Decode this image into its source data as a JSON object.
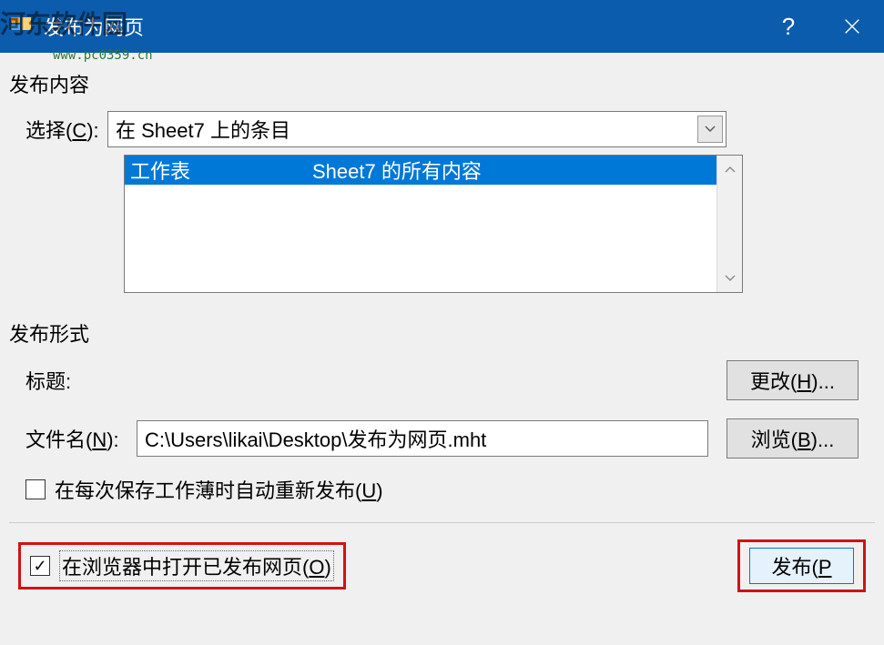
{
  "titlebar": {
    "title": "发布为网页",
    "help_symbol": "?",
    "watermark_text": "河东软件园",
    "watermark_url": "www.pc0359.cn"
  },
  "section_publish_content": {
    "title": "发布内容",
    "choose_label_prefix": "选择(",
    "choose_label_key": "C",
    "choose_label_suffix": "):",
    "choose_value": "在 Sheet7 上的条目",
    "list_item_col1": "工作表",
    "list_item_col2": "Sheet7 的所有内容"
  },
  "section_publish_form": {
    "title": "发布形式",
    "title_label": "标题:",
    "change_btn_prefix": "更改(",
    "change_btn_key": "H",
    "change_btn_suffix": ")...",
    "filename_label_prefix": "文件名(",
    "filename_label_key": "N",
    "filename_label_suffix": "):",
    "filename_value": "C:\\Users\\likai\\Desktop\\发布为网页.mht",
    "browse_btn_prefix": "浏览(",
    "browse_btn_key": "B",
    "browse_btn_suffix": ")...",
    "auto_republish_prefix": "在每次保存工作薄时自动重新发布(",
    "auto_republish_key": "U",
    "auto_republish_suffix": ")"
  },
  "bottom": {
    "open_browser_prefix": "在浏览器中打开已发布网页(",
    "open_browser_key": "O",
    "open_browser_suffix": ")",
    "publish_btn_prefix": "发布(",
    "publish_btn_key": "P"
  }
}
